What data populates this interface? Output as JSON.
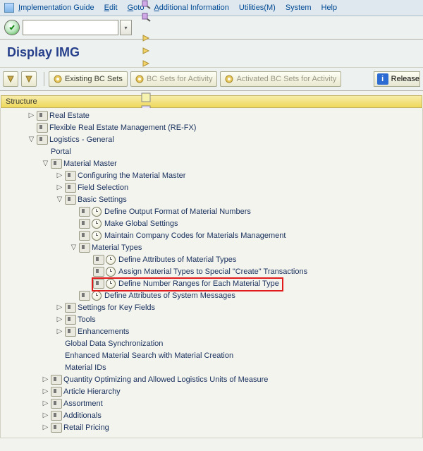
{
  "menu": {
    "items": [
      "Implementation Guide",
      "Edit",
      "Goto",
      "Additional Information",
      "Utilities(M)",
      "System",
      "Help"
    ],
    "underline_idx": [
      0,
      0,
      0,
      0,
      9,
      -1,
      -1
    ]
  },
  "toolbar": {
    "tcode_value": "",
    "icons": [
      "back",
      "save",
      "sep",
      "nav-back",
      "nav-forward",
      "cancel",
      "sep",
      "print",
      "find",
      "find-next",
      "sep",
      "first",
      "prev",
      "next",
      "last",
      "sep",
      "layout",
      "shortcut",
      "sep",
      "help",
      "customize"
    ]
  },
  "title": "Display IMG",
  "app_toolbar": {
    "buttons": [
      {
        "type": "icon",
        "name": "expand-subtree"
      },
      {
        "type": "icon",
        "name": "collapse-subtree"
      },
      {
        "type": "sep"
      },
      {
        "type": "text",
        "label": "Existing BC Sets",
        "enabled": true,
        "icon": true
      },
      {
        "type": "text",
        "label": "BC Sets for Activity",
        "enabled": false,
        "icon": true
      },
      {
        "type": "text",
        "label": "Activated BC Sets for Activity",
        "enabled": false,
        "icon": true
      },
      {
        "type": "release",
        "label": "Release"
      }
    ]
  },
  "structure_label": "Structure",
  "tree": [
    {
      "d": 1,
      "exp": "c",
      "ic": [
        "exec"
      ],
      "t": "Real Estate"
    },
    {
      "d": 1,
      "exp": "n",
      "ic": [
        "exec"
      ],
      "t": "Flexible Real Estate Management (RE-FX)"
    },
    {
      "d": 1,
      "exp": "o",
      "ic": [
        "exec"
      ],
      "t": "Logistics - General"
    },
    {
      "d": 2,
      "exp": "n",
      "ic": [],
      "t": "Portal"
    },
    {
      "d": 2,
      "exp": "o",
      "ic": [
        "exec"
      ],
      "t": "Material Master"
    },
    {
      "d": 3,
      "exp": "c",
      "ic": [
        "exec"
      ],
      "t": "Configuring the Material Master"
    },
    {
      "d": 3,
      "exp": "c",
      "ic": [
        "exec"
      ],
      "t": "Field Selection"
    },
    {
      "d": 3,
      "exp": "o",
      "ic": [
        "exec"
      ],
      "t": "Basic Settings"
    },
    {
      "d": 4,
      "exp": "n",
      "ic": [
        "exec",
        "clock"
      ],
      "t": "Define Output Format of Material Numbers"
    },
    {
      "d": 4,
      "exp": "n",
      "ic": [
        "exec",
        "clock"
      ],
      "t": "Make Global Settings"
    },
    {
      "d": 4,
      "exp": "n",
      "ic": [
        "exec",
        "clock"
      ],
      "t": "Maintain Company Codes for Materials Management"
    },
    {
      "d": 4,
      "exp": "o",
      "ic": [
        "exec"
      ],
      "t": "Material Types"
    },
    {
      "d": 5,
      "exp": "n",
      "ic": [
        "exec",
        "clock"
      ],
      "t": "Define Attributes of Material Types"
    },
    {
      "d": 5,
      "exp": "n",
      "ic": [
        "exec",
        "clock"
      ],
      "t": "Assign Material Types to Special \"Create\" Transactions"
    },
    {
      "d": 5,
      "exp": "n",
      "ic": [
        "exec",
        "clock"
      ],
      "t": "Define Number Ranges for Each Material Type",
      "hl": true
    },
    {
      "d": 4,
      "exp": "n",
      "ic": [
        "exec",
        "clock"
      ],
      "t": "Define Attributes of System Messages"
    },
    {
      "d": 3,
      "exp": "c",
      "ic": [
        "exec"
      ],
      "t": "Settings for Key Fields"
    },
    {
      "d": 3,
      "exp": "c",
      "ic": [
        "exec"
      ],
      "t": "Tools"
    },
    {
      "d": 3,
      "exp": "c",
      "ic": [
        "exec"
      ],
      "t": "Enhancements"
    },
    {
      "d": 3,
      "exp": "n",
      "ic": [],
      "t": "Global Data Synchronization"
    },
    {
      "d": 3,
      "exp": "n",
      "ic": [],
      "t": "Enhanced Material Search with Material Creation"
    },
    {
      "d": 3,
      "exp": "n",
      "ic": [],
      "t": "Material IDs"
    },
    {
      "d": 2,
      "exp": "c",
      "ic": [
        "exec"
      ],
      "t": "Quantity Optimizing and Allowed Logistics Units of Measure"
    },
    {
      "d": 2,
      "exp": "c",
      "ic": [
        "exec"
      ],
      "t": "Article Hierarchy"
    },
    {
      "d": 2,
      "exp": "c",
      "ic": [
        "exec"
      ],
      "t": "Assortment"
    },
    {
      "d": 2,
      "exp": "c",
      "ic": [
        "exec"
      ],
      "t": "Additionals"
    },
    {
      "d": 2,
      "exp": "c",
      "ic": [
        "exec"
      ],
      "t": "Retail Pricing"
    }
  ]
}
